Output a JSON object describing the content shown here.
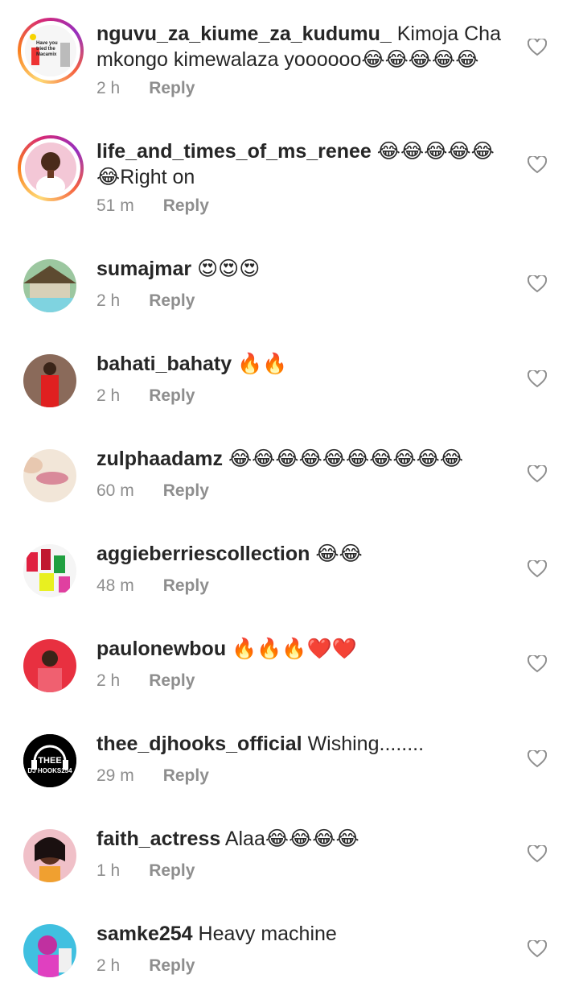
{
  "comments": [
    {
      "user": "nguvu_za_kiume_za_kudumu_",
      "text": "Kimoja Cha mkongo kimewalaza yoooooo😂😂😂😂😂",
      "time": "2 h",
      "reply": "Reply",
      "avatar_text": "Have you tried the Macamix"
    },
    {
      "user": "life_and_times_of_ms_renee",
      "text": "😂😂😂😂😂😂Right on",
      "time": "51 m",
      "reply": "Reply"
    },
    {
      "user": "sumajmar",
      "text": "😍😍😍",
      "time": "2 h",
      "reply": "Reply"
    },
    {
      "user": "bahati_bahaty",
      "text": "🔥🔥",
      "time": "2 h",
      "reply": "Reply"
    },
    {
      "user": "zulphaadamz",
      "text": "😂😂😂😂😂😂😂😂😂😂",
      "time": "60 m",
      "reply": "Reply"
    },
    {
      "user": "aggieberriescollection",
      "text": "😂😂",
      "time": "48 m",
      "reply": "Reply"
    },
    {
      "user": "paulonewbou",
      "text": "🔥🔥🔥❤️❤️",
      "time": "2 h",
      "reply": "Reply"
    },
    {
      "user": "thee_djhooks_official",
      "text": "Wishing........",
      "time": "29 m",
      "reply": "Reply",
      "avatar_text_1": "THEE",
      "avatar_text_2": "DJ HOOKS254"
    },
    {
      "user": "faith_actress",
      "text": "Alaa😂😂😂😂",
      "time": "1 h",
      "reply": "Reply"
    },
    {
      "user": "samke254",
      "text": "Heavy machine",
      "time": "2 h",
      "reply": "Reply"
    }
  ],
  "icons": {
    "like": "heart-outline-icon"
  },
  "colors": {
    "username": "#262626",
    "meta": "#8e8e8e",
    "story_ring": "#d62976"
  }
}
